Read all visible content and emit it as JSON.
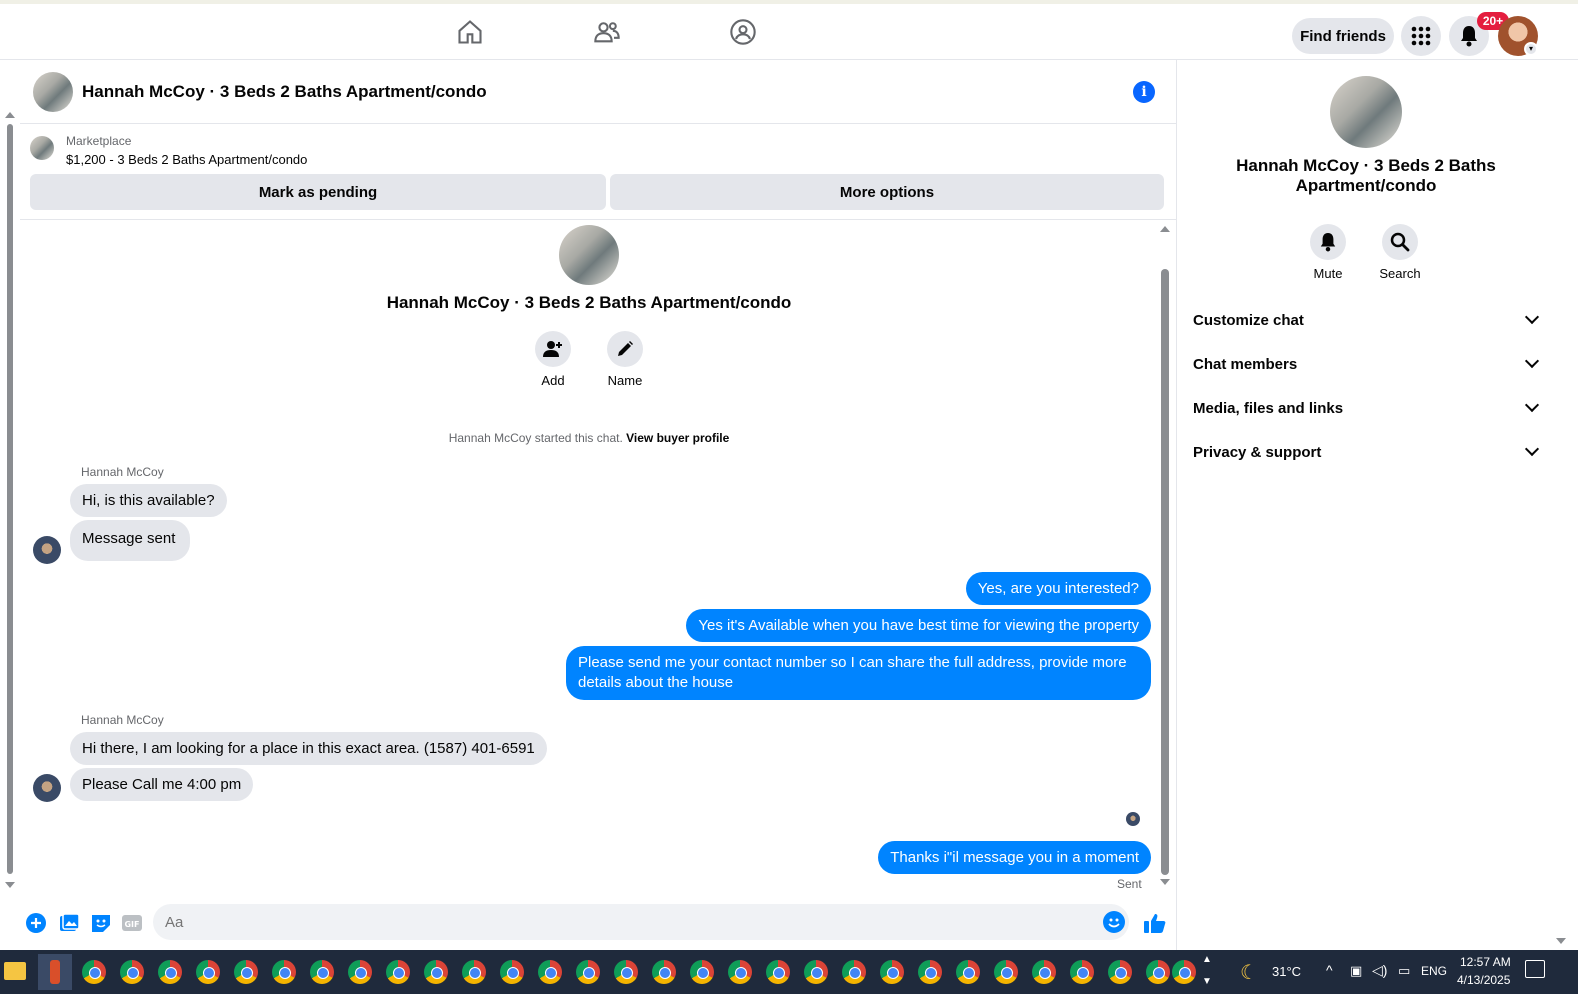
{
  "topbar": {
    "find_friends": "Find friends",
    "notification_badge": "20+"
  },
  "chat": {
    "title": "Hannah McCoy · 3 Beds 2 Baths Apartment/condo",
    "marketplace_label": "Marketplace",
    "listing": "$1,200 - 3 Beds 2 Baths Apartment/condo",
    "mark_pending": "Mark as pending",
    "more_options": "More options",
    "hero_title": "Hannah McCoy · 3 Beds 2 Baths Apartment/condo",
    "add_label": "Add",
    "name_label": "Name",
    "started_text": "Hannah McCoy started this chat.",
    "view_profile": "View buyer profile",
    "messages": [
      {
        "from": "Hannah McCoy",
        "text": "Hi, is this available?"
      },
      {
        "from": "Hannah McCoy",
        "text": "Message sent"
      },
      {
        "from": "me",
        "text": "Yes, are you interested?"
      },
      {
        "from": "me",
        "text": "Yes it's Available when you have best time for viewing the property"
      },
      {
        "from": "me",
        "text": "Please send me your contact number so I can share the full address, provide more"
      },
      {
        "from": "me",
        "text": "details about the house"
      },
      {
        "from": "Hannah McCoy",
        "text": "Hi there, I am looking for a place in this exact area. (1587) 401-6591"
      },
      {
        "from": "Hannah McCoy",
        "text": "Please Call me 4:00 pm"
      },
      {
        "from": "me",
        "text": "Thanks i\"il message you in a moment"
      }
    ],
    "sender_name": "Hannah McCoy",
    "sent_label": "Sent",
    "composer_placeholder": "Aa"
  },
  "right_panel": {
    "title_line1": "Hannah McCoy · 3 Beds 2 Baths",
    "title_line2": "Apartment/condo",
    "mute": "Mute",
    "search": "Search",
    "sections": [
      "Customize chat",
      "Chat members",
      "Media, files and links",
      "Privacy & support"
    ]
  },
  "taskbar": {
    "temperature": "31°C",
    "language": "ENG",
    "time": "12:57 AM",
    "date": "4/13/2025"
  },
  "colors": {
    "accent": "#0084ff",
    "bubble_in": "#e4e6eb",
    "badge": "#e41e3f"
  }
}
